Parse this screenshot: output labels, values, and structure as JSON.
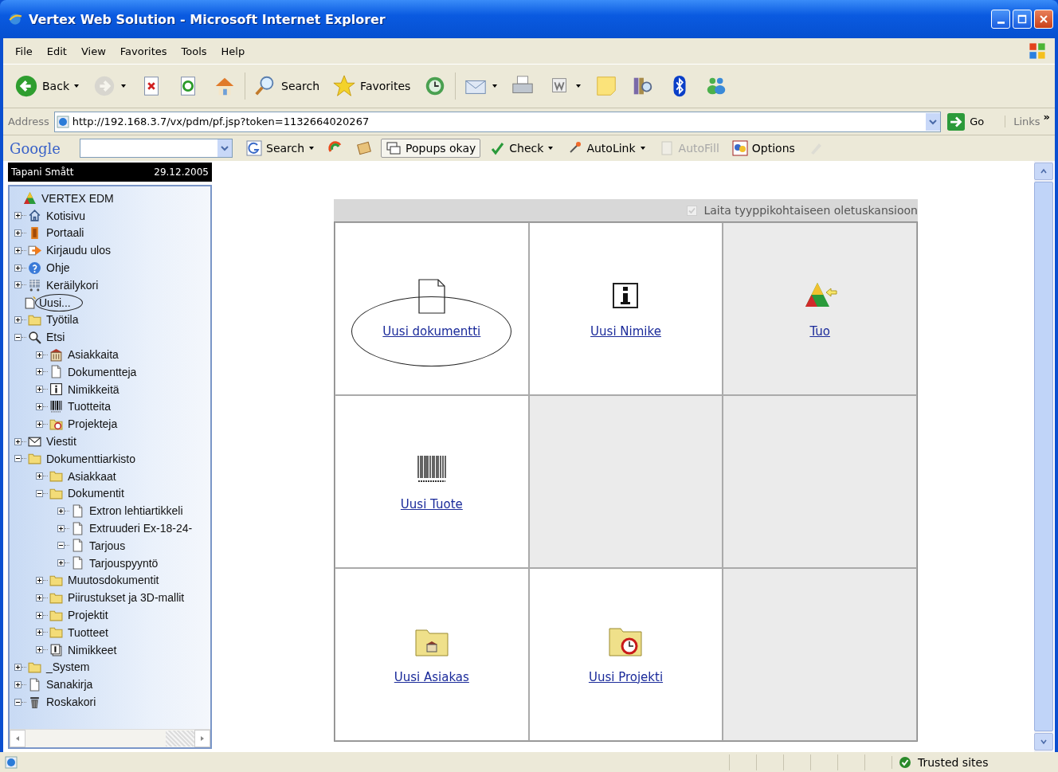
{
  "window": {
    "title": "Vertex Web Solution - Microsoft Internet Explorer"
  },
  "menu": [
    "File",
    "Edit",
    "View",
    "Favorites",
    "Tools",
    "Help"
  ],
  "toolbar": [
    {
      "kind": "back",
      "label": "Back",
      "dropdown": true,
      "disabled": false
    },
    {
      "kind": "forward",
      "dropdown": true,
      "disabled": true
    },
    {
      "kind": "stop",
      "disabled": false
    },
    {
      "kind": "refresh",
      "disabled": false
    },
    {
      "kind": "home",
      "disabled": false
    },
    {
      "kind": "search",
      "label": "Search",
      "disabled": false
    },
    {
      "kind": "favorites",
      "label": "Favorites",
      "disabled": false
    },
    {
      "kind": "history",
      "disabled": false
    },
    {
      "kind": "mail",
      "dropdown": true,
      "disabled": false
    },
    {
      "kind": "print",
      "disabled": false
    },
    {
      "kind": "word",
      "dropdown": true,
      "disabled": false
    },
    {
      "kind": "note",
      "disabled": false
    },
    {
      "kind": "research",
      "disabled": false
    },
    {
      "kind": "bluetooth",
      "disabled": false
    },
    {
      "kind": "messenger",
      "disabled": false
    }
  ],
  "address": {
    "label": "Address",
    "url": "http://192.168.3.7/vx/pdm/pf.jsp?token=1132664020267",
    "go": "Go",
    "links": "Links",
    "more": "»"
  },
  "google_bar": {
    "logo": "Google",
    "buttons": [
      {
        "kind": "search",
        "label": "Search",
        "dropdown": true,
        "disabled": false
      },
      {
        "kind": "pagerank",
        "disabled": false
      },
      {
        "kind": "news",
        "disabled": false
      },
      {
        "kind": "popups",
        "label": "Popups okay",
        "disabled": false
      },
      {
        "kind": "check",
        "label": "Check",
        "dropdown": true,
        "disabled": false
      },
      {
        "kind": "autolink",
        "label": "AutoLink",
        "dropdown": true,
        "disabled": false
      },
      {
        "kind": "autofill",
        "label": "AutoFill",
        "disabled": true
      },
      {
        "kind": "options",
        "label": "Options",
        "disabled": false
      },
      {
        "kind": "highlight",
        "disabled": true
      }
    ]
  },
  "sidebar": {
    "user": "Tapani Smått",
    "date": "29.12.2005",
    "tree": [
      {
        "label": "VERTEX EDM",
        "kind": "root",
        "circled": false
      },
      {
        "label": "Kotisivu",
        "kind": "home",
        "expanded": false,
        "circled": false
      },
      {
        "label": "Portaali",
        "kind": "door",
        "expanded": false,
        "circled": false
      },
      {
        "label": "Kirjaudu ulos",
        "kind": "logout",
        "expanded": false,
        "circled": false
      },
      {
        "label": "Ohje",
        "kind": "help",
        "expanded": false,
        "circled": false
      },
      {
        "label": "Keräilykori",
        "kind": "cart",
        "expanded": false,
        "circled": false
      },
      {
        "label": "Uusi...",
        "kind": "new",
        "circled": true
      },
      {
        "label": "Työtila",
        "kind": "workspace",
        "expanded": false,
        "circled": false
      },
      {
        "label": "Etsi",
        "kind": "search",
        "expanded": true,
        "circled": false,
        "children": [
          {
            "label": "Asiakkaita",
            "kind": "building",
            "expanded": false,
            "circled": false
          },
          {
            "label": "Dokumentteja",
            "kind": "document",
            "expanded": false,
            "circled": false
          },
          {
            "label": "Nimikkeitä",
            "kind": "info",
            "expanded": false,
            "circled": false
          },
          {
            "label": "Tuotteita",
            "kind": "barcode",
            "expanded": false,
            "circled": false
          },
          {
            "label": "Projekteja",
            "kind": "project",
            "expanded": false,
            "circled": false
          }
        ]
      },
      {
        "label": "Viestit",
        "kind": "mail",
        "expanded": false,
        "circled": false
      },
      {
        "label": "Dokumenttiarkisto",
        "kind": "folder",
        "expanded": true,
        "circled": false,
        "children": [
          {
            "label": "Asiakkaat",
            "kind": "folder",
            "expanded": false,
            "circled": false
          },
          {
            "label": "Dokumentit",
            "kind": "folder",
            "expanded": true,
            "circled": false,
            "children": [
              {
                "label": "Extron lehtiartikkeli",
                "kind": "document",
                "expanded": false,
                "circled": false
              },
              {
                "label": "Extruuderi Ex-18-24-",
                "kind": "document",
                "expanded": false,
                "circled": false
              },
              {
                "label": "Tarjous",
                "kind": "document",
                "expanded": true,
                "circled": false
              },
              {
                "label": "Tarjouspyyntö",
                "kind": "document",
                "expanded": false,
                "circled": false
              }
            ]
          },
          {
            "label": "Muutosdokumentit",
            "kind": "folder",
            "expanded": false,
            "circled": false
          },
          {
            "label": "Piirustukset ja 3D-mallit",
            "kind": "folder",
            "expanded": false,
            "circled": false
          },
          {
            "label": "Projektit",
            "kind": "folder",
            "expanded": false,
            "circled": false
          },
          {
            "label": "Tuotteet",
            "kind": "folder",
            "expanded": false,
            "circled": false
          },
          {
            "label": "Nimikkeet",
            "kind": "stack",
            "expanded": false,
            "circled": false
          }
        ]
      },
      {
        "label": "_System",
        "kind": "folder",
        "expanded": false,
        "circled": false
      },
      {
        "label": "Sanakirja",
        "kind": "document",
        "expanded": false,
        "circled": false
      },
      {
        "label": "Roskakori",
        "kind": "trash",
        "expanded": true,
        "circled": false
      }
    ]
  },
  "panel": {
    "checkbox": {
      "label": "Laita tyyppikohtaiseen oletuskansioon",
      "checked": true,
      "disabled": true
    },
    "cells": [
      {
        "kind": "document",
        "label": "Uusi dokumentti",
        "circled": true,
        "shaded": false
      },
      {
        "kind": "info",
        "label": "Uusi Nimike",
        "circled": false,
        "shaded": false
      },
      {
        "kind": "import",
        "label": "Tuo",
        "circled": false,
        "shaded": true
      },
      {
        "kind": "barcode",
        "label": "Uusi Tuote",
        "circled": false,
        "shaded": false
      },
      {
        "kind": "empty",
        "shaded": true
      },
      {
        "kind": "empty",
        "shaded": true
      },
      {
        "kind": "customer",
        "label": "Uusi Asiakas",
        "circled": false,
        "shaded": false
      },
      {
        "kind": "project",
        "label": "Uusi Projekti",
        "circled": false,
        "shaded": false
      },
      {
        "kind": "empty",
        "shaded": true
      }
    ]
  },
  "status_bar": {
    "zone": "Trusted sites"
  }
}
